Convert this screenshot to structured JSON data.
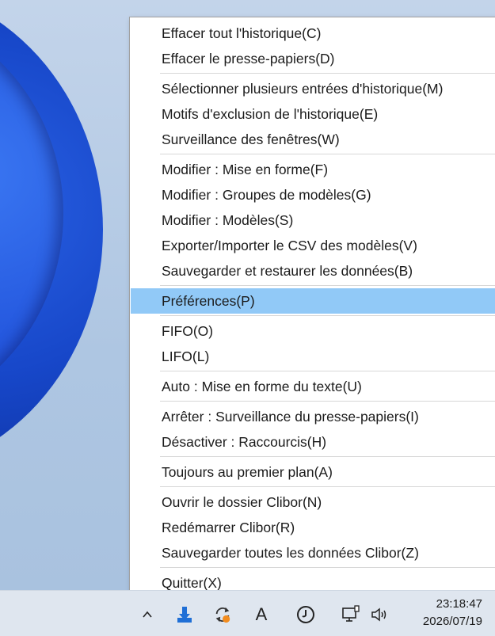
{
  "menu": {
    "items": [
      {
        "label": "Effacer tout l'historique(C)"
      },
      {
        "label": "Effacer le presse-papiers(D)"
      },
      {
        "label": "Sélectionner plusieurs entrées d'historique(M)"
      },
      {
        "label": "Motifs d'exclusion de l'historique(E)"
      },
      {
        "label": "Surveillance des fenêtres(W)"
      },
      {
        "label": "Modifier : Mise en forme(F)"
      },
      {
        "label": "Modifier : Groupes de modèles(G)"
      },
      {
        "label": "Modifier : Modèles(S)"
      },
      {
        "label": "Exporter/Importer le CSV des modèles(V)"
      },
      {
        "label": "Sauvegarder et restaurer les données(B)"
      },
      {
        "label": "Préférences(P)",
        "highlighted": true
      },
      {
        "label": "FIFO(O)"
      },
      {
        "label": "LIFO(L)"
      },
      {
        "label": "Auto : Mise en forme du texte(U)",
        "has_submenu": true
      },
      {
        "label": "Arrêter : Surveillance du presse-papiers(I)"
      },
      {
        "label": "Désactiver : Raccourcis(H)"
      },
      {
        "label": "Toujours au premier plan(A)"
      },
      {
        "label": "Ouvrir le dossier Clibor(N)"
      },
      {
        "label": "Redémarrer Clibor(R)"
      },
      {
        "label": "Sauvegarder toutes les données Clibor(Z)"
      },
      {
        "label": "Quitter(X)"
      }
    ],
    "highlight_color": "#91c9f7"
  },
  "taskbar": {
    "clock_time": "23:18:47",
    "clock_date": "2026/07/19",
    "icons": [
      "chevron-up-icon",
      "download-arrow-icon",
      "clibor-refresh-icon",
      "font-a-icon",
      "clock-icon",
      "network-icon",
      "speaker-icon"
    ]
  }
}
